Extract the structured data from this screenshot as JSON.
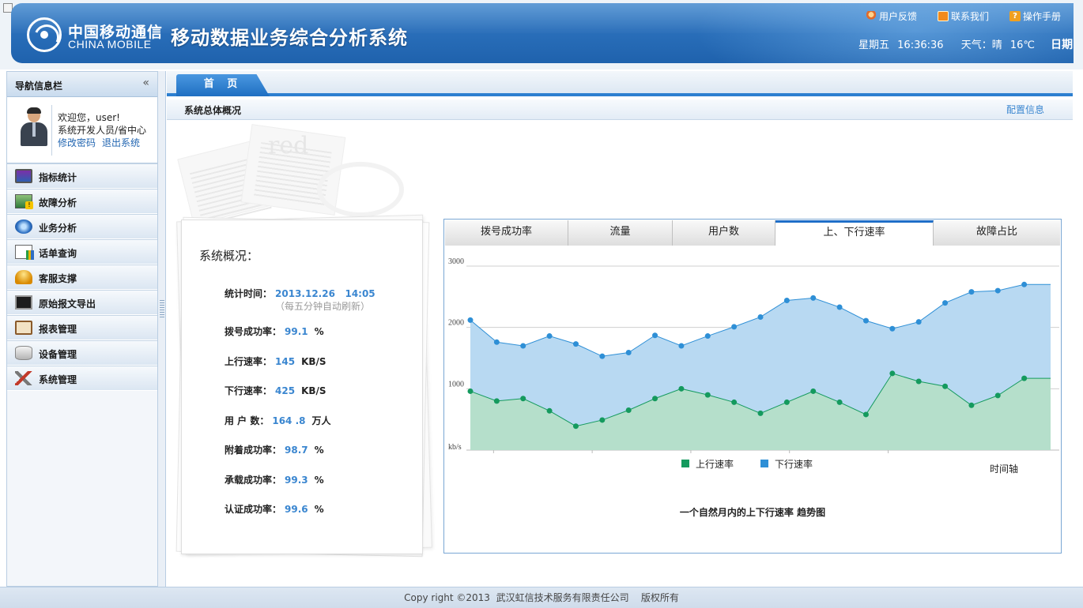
{
  "header": {
    "brand_cn": "中国移动通信",
    "brand_en": "CHINA MOBILE",
    "app_title": "移动数据业务综合分析系统",
    "links": [
      {
        "label": "用户反馈",
        "icon": "user-feedback-icon"
      },
      {
        "label": "联系我们",
        "icon": "contact-icon"
      },
      {
        "label": "操作手册",
        "icon": "manual-icon"
      }
    ],
    "weekday": "星期五",
    "time": "16:36:36",
    "weather_label": "天气：晴",
    "temperature": "16℃",
    "calendar": "日期"
  },
  "sidebar": {
    "title": "导航信息栏",
    "collapse": "«",
    "welcome": "欢迎您，user!",
    "role": "系统开发人员/省中心",
    "change_password": "修改密码",
    "logout": "退出系统",
    "items": [
      {
        "label": "指标统计",
        "icon": "monitor-icon"
      },
      {
        "label": "故障分析",
        "icon": "fault-warning-icon"
      },
      {
        "label": "业务分析",
        "icon": "compass-icon"
      },
      {
        "label": "话单查询",
        "icon": "bill-report-icon"
      },
      {
        "label": "客服支撑",
        "icon": "bell-icon"
      },
      {
        "label": "原始报文导出",
        "icon": "terminal-icon"
      },
      {
        "label": "报表管理",
        "icon": "clipboard-icon"
      },
      {
        "label": "设备管理",
        "icon": "database-icon"
      },
      {
        "label": "系统管理",
        "icon": "tools-icon"
      }
    ]
  },
  "tabs": {
    "home": "首 页"
  },
  "section": {
    "title": "系统总体概况",
    "config_link": "配置信息"
  },
  "overview": {
    "title": "系统概况：",
    "stat_time_label": "统计时间：",
    "stat_time_value": "2013.12.26   14:05",
    "refresh_note": "（每五分钟自动刷新）",
    "metrics": [
      {
        "label": "拨号成功率：",
        "value": "99.1",
        "unit": "%"
      },
      {
        "label": "上行速率：",
        "value": "145",
        "unit": "KB/S"
      },
      {
        "label": "下行速率：",
        "value": "425",
        "unit": "KB/S"
      },
      {
        "label": "用 户 数：",
        "value": "164 .8",
        "unit": "万人"
      },
      {
        "label": "附着成功率：",
        "value": "98.7",
        "unit": "%"
      },
      {
        "label": "承载成功率：",
        "value": "99.3",
        "unit": "%"
      },
      {
        "label": "认证成功率：",
        "value": "99.6",
        "unit": "%"
      }
    ]
  },
  "chart_tabs": [
    {
      "label": "拨号成功率",
      "active": false
    },
    {
      "label": "流量",
      "active": false
    },
    {
      "label": "用户数",
      "active": false
    },
    {
      "label": "上、下行速率",
      "active": true
    },
    {
      "label": "故障占比",
      "active": false
    }
  ],
  "chart_data": {
    "type": "area",
    "title": "一个自然月内的上下行速率 趋势图",
    "xlabel": "时间轴",
    "ylabel": "kb/s",
    "ylim": [
      0,
      3000
    ],
    "yticks": [
      "1000",
      "2000",
      "3000"
    ],
    "x": [
      1,
      2,
      3,
      4,
      5,
      6,
      7,
      8,
      9,
      10,
      11,
      12,
      13,
      14,
      15,
      16,
      17,
      18,
      19,
      20,
      21,
      22,
      23
    ],
    "series": [
      {
        "name": "上行速率",
        "color": "#149a5e",
        "fill": "#b5dfcb",
        "values": [
          960,
          800,
          840,
          640,
          390,
          490,
          650,
          840,
          1000,
          900,
          780,
          600,
          780,
          960,
          780,
          580,
          1250,
          1120,
          1040,
          730,
          890,
          1170,
          1170
        ]
      },
      {
        "name": "下行速率",
        "color": "#2e8fd6",
        "fill": "#b8d9f2",
        "values": [
          2120,
          1760,
          1700,
          1860,
          1730,
          1530,
          1590,
          1870,
          1700,
          1860,
          2010,
          2170,
          2440,
          2480,
          2330,
          2110,
          1980,
          2090,
          2400,
          2580,
          2600,
          2700,
          2700
        ]
      }
    ],
    "legend_position": "bottom"
  },
  "footer": {
    "copyright": "Copy right ©2013  武汉虹信技术服务有限责任公司    版权所有"
  }
}
